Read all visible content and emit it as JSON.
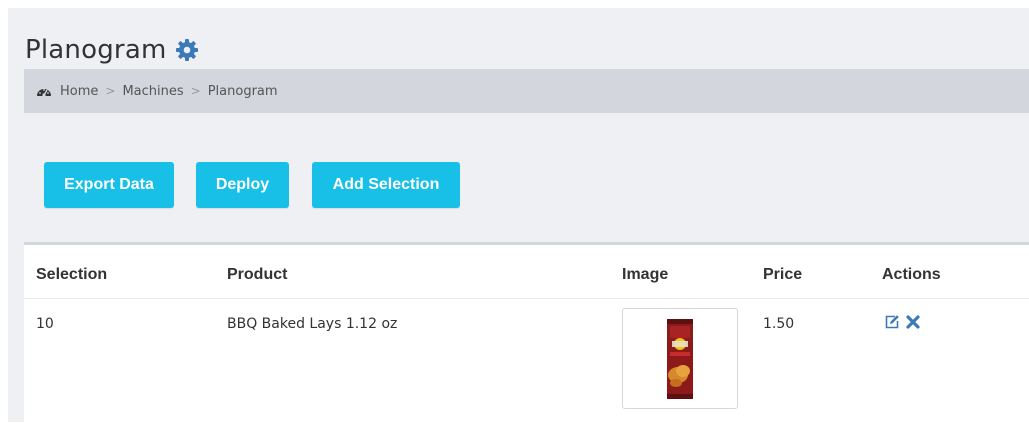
{
  "page": {
    "title": "Planogram"
  },
  "breadcrumb": {
    "items": [
      "Home",
      "Machines",
      "Planogram"
    ],
    "separator": ">"
  },
  "toolbar": {
    "export_label": "Export Data",
    "deploy_label": "Deploy",
    "add_label": "Add Selection"
  },
  "table": {
    "headers": {
      "selection": "Selection",
      "product": "Product",
      "image": "Image",
      "price": "Price",
      "actions": "Actions"
    },
    "rows": [
      {
        "selection": "10",
        "product": "BBQ Baked Lays 1.12 oz",
        "price": "1.50",
        "image_icon": "chip-bag-image"
      }
    ]
  },
  "icons": {
    "title": "gear-icon",
    "breadcrumb": "dashboard-icon",
    "edit": "edit-icon",
    "delete": "delete-icon"
  },
  "colors": {
    "accent": "#18bfe6",
    "icon_blue": "#3a7ab8",
    "background": "#eef0f4",
    "breadcrumb_bg": "#d3d6dc"
  }
}
